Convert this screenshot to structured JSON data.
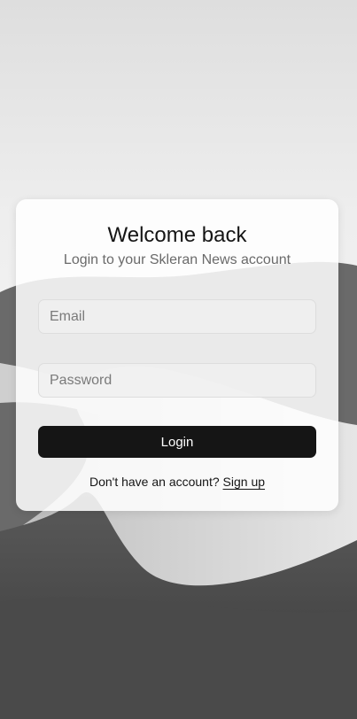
{
  "login": {
    "title": "Welcome back",
    "subtitle": "Login to your Skleran News account",
    "email_placeholder": "Email",
    "password_placeholder": "Password",
    "login_label": "Login",
    "no_account_text": "Don't have an account?",
    "signup_label": "Sign up"
  },
  "colors": {
    "button_bg": "#151515",
    "card_bg": "#ffffff",
    "dunes": "#4a4a4a"
  }
}
